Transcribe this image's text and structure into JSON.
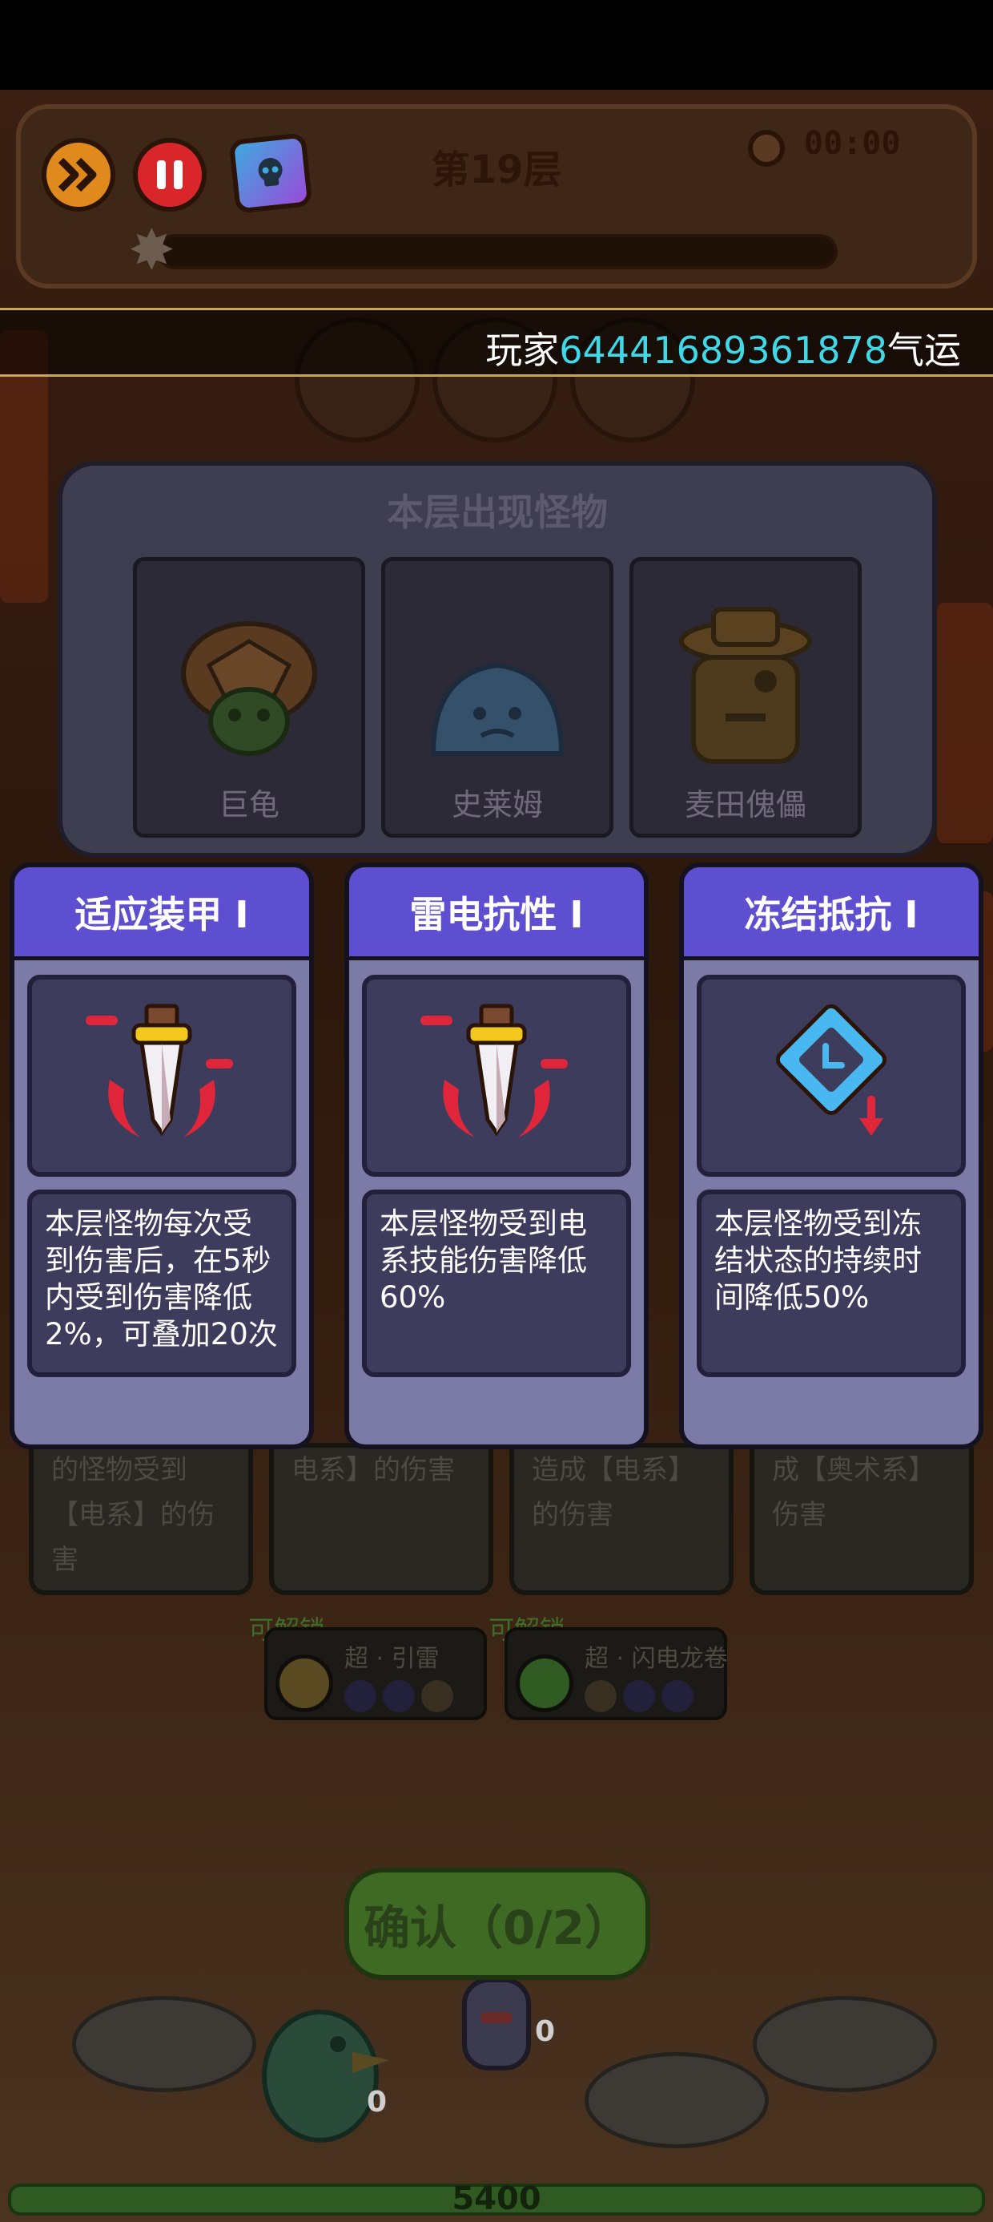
{
  "top_bar": {
    "floor_title": "第19层",
    "timer": "00:00"
  },
  "broadcast": {
    "prefix": "玩家",
    "player_id": "64441689361878",
    "suffix": "气运"
  },
  "monster_panel": {
    "title": "本层出现怪物",
    "monsters": [
      {
        "name": "巨龟"
      },
      {
        "name": "史莱姆"
      },
      {
        "name": "麦田傀儡"
      }
    ]
  },
  "buff_cards": [
    {
      "title": "适应装甲 I",
      "icon": "sword-shield-icon",
      "description": "本层怪物每次受到伤害后，在5秒内受到伤害降低2%，可叠加20次"
    },
    {
      "title": "雷电抗性 I",
      "icon": "sword-shield-icon",
      "description": "本层怪物受到电系技能伤害降低60%"
    },
    {
      "title": "冻结抵抗 I",
      "icon": "freeze-clock-icon",
      "description": "本层怪物受到冻结状态的持续时间降低50%"
    }
  ],
  "background_skills": {
    "card_texts": [
      "的怪物受到【电系】的伤害",
      "电系】的伤害",
      "造成【电系】的伤害",
      "成【奥术系】伤害"
    ],
    "unlock_label": "可解锁",
    "unlockables": [
      {
        "name": "超 · 引雷"
      },
      {
        "name": "超 · 闪电龙卷"
      }
    ]
  },
  "confirm": {
    "label": "确认（0/2）"
  },
  "battle": {
    "counter_a": "0",
    "counter_b": "0",
    "hp": "5400"
  },
  "colors": {
    "card_header": "#5e4fd0",
    "card_body": "#7c7aa6",
    "player_id": "#3fd8e8",
    "confirm_green": "#3f6a24"
  }
}
